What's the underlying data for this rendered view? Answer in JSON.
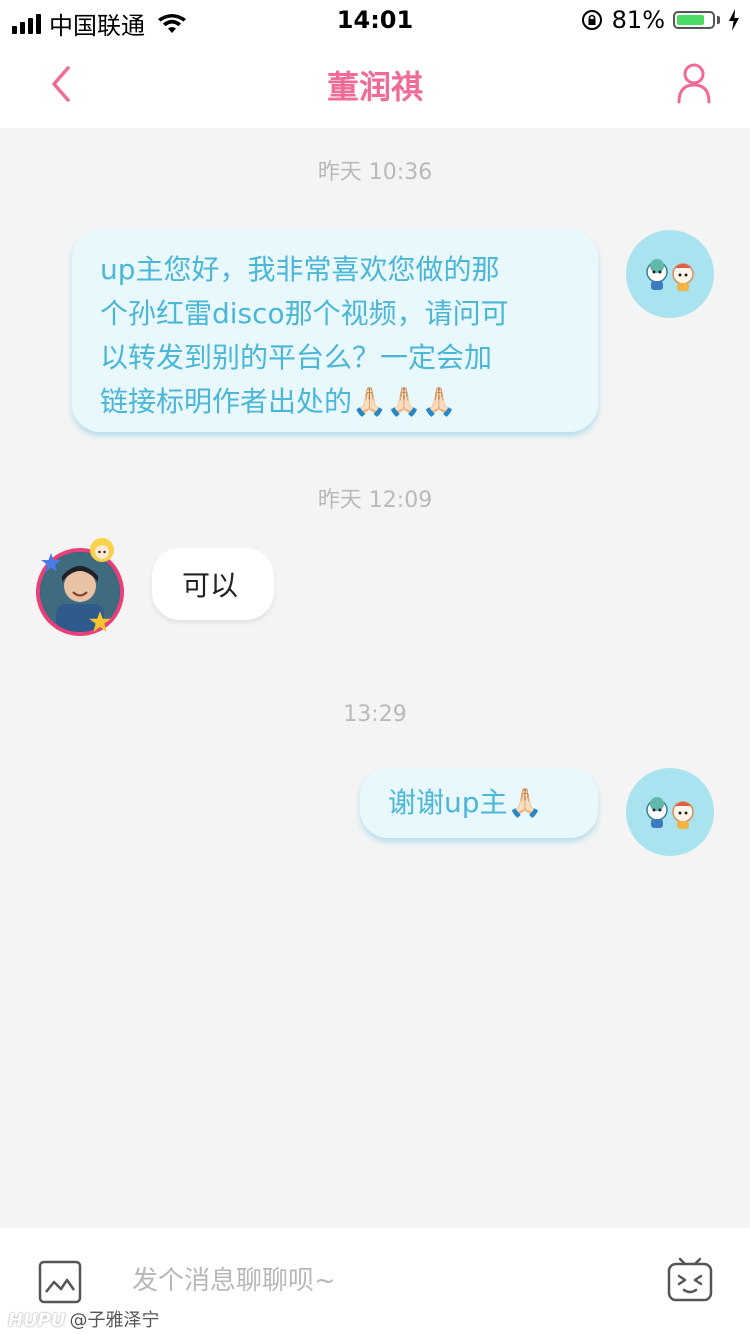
{
  "status_bar": {
    "carrier": "中国联通",
    "time": "14:01",
    "battery_percent": "81%",
    "battery_level": 0.81,
    "battery_color": "#4cd964"
  },
  "nav": {
    "title": "董润祺",
    "back_icon": "chevron-left-icon",
    "user_icon": "user-icon",
    "accent_color": "#f06b95"
  },
  "messages": [
    {
      "timestamp": "昨天 10:36",
      "sender": "self",
      "lines": [
        "up主您好，我非常喜欢您做的那",
        "个孙红雷disco那个视频，请问可",
        "以转发到别的平台么？一定会加",
        "链接标明作者出处的🙏🏻🙏🏻🙏🏻"
      ]
    },
    {
      "timestamp": "昨天 12:09",
      "sender": "other",
      "text": "可以"
    },
    {
      "timestamp": "13:29",
      "sender": "self",
      "text": "谢谢up主🙏🏻"
    }
  ],
  "input": {
    "placeholder": "发个消息聊聊呗~",
    "value": "",
    "image_icon": "image-icon",
    "emoji_icon": "emoji-icon"
  },
  "watermark": {
    "brand": "HUPU",
    "handle": "@子雅泽宁"
  },
  "colors": {
    "self_bubble_bg": "#e8f8fd",
    "self_bubble_text": "#4bb6d6",
    "other_bubble_bg": "#ffffff",
    "background": "#f4f4f4"
  }
}
